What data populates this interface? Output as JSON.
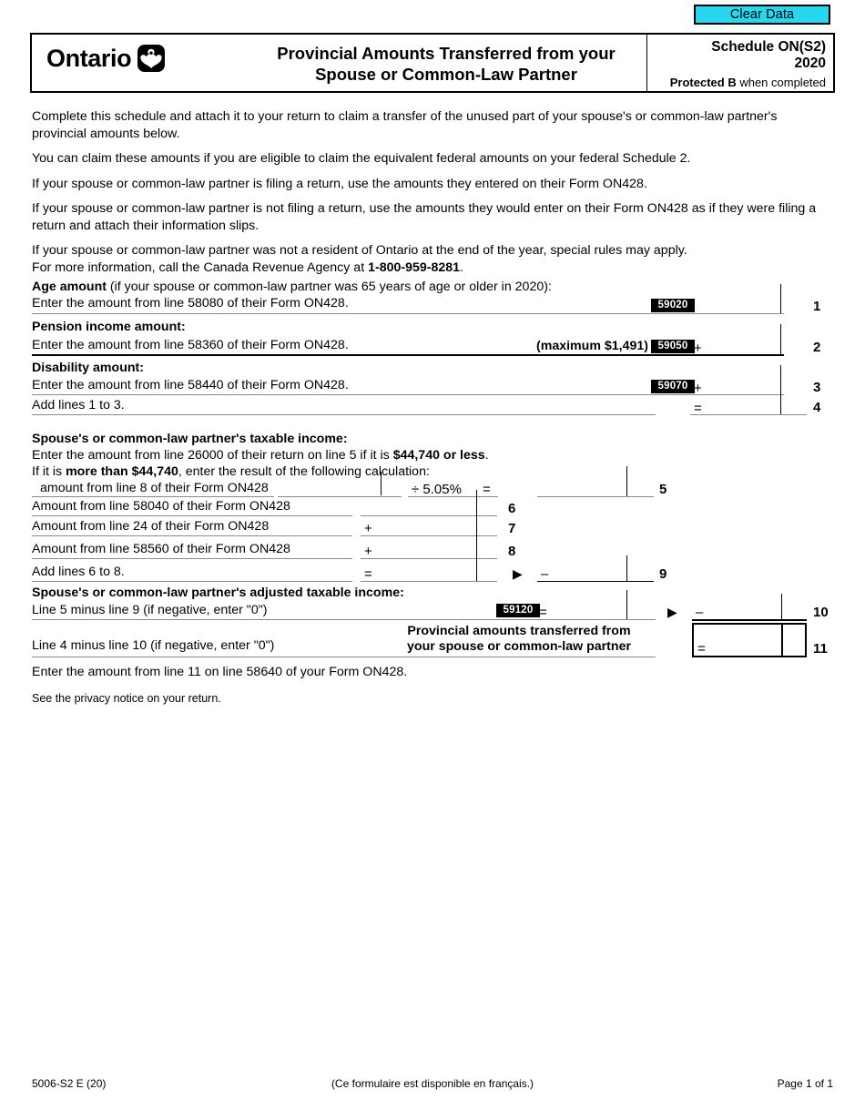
{
  "toolbar": {
    "clear_data_label": "Clear Data",
    "clear_data_color": "#27d7ee"
  },
  "header": {
    "province": "Ontario",
    "logo_icon": "ontario-trillium-icon",
    "title_line1": "Provincial Amounts Transferred from your",
    "title_line2": "Spouse or Common-Law Partner",
    "schedule": "Schedule ON(S2)",
    "year": "2020",
    "protected_bold": "Protected B",
    "protected_rest": " when completed"
  },
  "intro": {
    "p1_a": "Complete this schedule and attach it to your return to claim a transfer of the unused part of your spouse's or common-law partner's provincial amounts below.",
    "p2": "You can claim these amounts if you are eligible to claim the equivalent federal amounts on your federal Schedule 2.",
    "p3": "If your spouse or common-law partner is filing a return, use the amounts they entered on their Form ON428.",
    "p4": "If your spouse or common-law partner is not filing a return, use the amounts they would enter on their Form ON428 as if they were filing a return and attach their information slips.",
    "p5_a": "If your spouse or common-law partner was not a resident of Ontario at the end of the year, special rules may apply.",
    "p5_b": "For more information, call the Canada Revenue Agency at ",
    "p5_phone": "1-800-959-8281",
    "p5_c": "."
  },
  "lines": {
    "l1": {
      "heading_bold": "Age amount",
      "heading_rest": " (if your spouse or common-law partner was 65 years of age or older in 2020):",
      "sub": "Enter the amount from line 58080 of their Form ON428.",
      "code": "59020",
      "number": "1",
      "value": ""
    },
    "l2": {
      "heading": "Pension income amount:",
      "sub": "Enter the amount from line 58360 of their Form ON428.",
      "maximum": "(maximum $1,491)",
      "code": "59050",
      "op": "+",
      "number": "2",
      "value": ""
    },
    "l3": {
      "heading": "Disability amount:",
      "sub": "Enter the amount from line 58440 of their Form ON428.",
      "code": "59070",
      "op": "+",
      "number": "3",
      "value": ""
    },
    "l4": {
      "label": "Add lines 1 to 3.",
      "op": "=",
      "number": "4",
      "value": ""
    },
    "l5": {
      "heading": "Spouse's or common-law partner's taxable income:",
      "sub1_a": "Enter the amount from line 26000 of their return on line 5 if it is ",
      "sub1_bold": "$44,740 or less",
      "sub1_b": ".",
      "sub2_a": "If it is ",
      "sub2_bold": "more than $44,740",
      "sub2_b": ", enter the result of the following calculation:",
      "calc_label": "amount from line 8 of their Form ON428",
      "divider_op": "÷  5.05%",
      "equals_op": "=",
      "number": "5",
      "value_a": "",
      "value_b": ""
    },
    "l6": {
      "label": "Amount from line 58040 of their Form ON428",
      "number": "6",
      "value": ""
    },
    "l7": {
      "label": "Amount from line 24 of their Form ON428",
      "op": "+",
      "number": "7",
      "value": ""
    },
    "l8": {
      "label": "Amount from line 58560 of their Form ON428",
      "op": "+",
      "number": "8",
      "value": ""
    },
    "l9": {
      "label": "Add lines 6 to 8.",
      "op": "=",
      "arrow": "▶",
      "minus": "–",
      "number": "9",
      "value_a": "",
      "value_b": ""
    },
    "l10": {
      "heading": "Spouse's or common-law partner's adjusted taxable income:",
      "sub": "Line 5 minus line 9 (if negative, enter \"0\")",
      "code": "59120",
      "op": "=",
      "arrow": "▶",
      "minus": "–",
      "number": "10",
      "value_a": "",
      "value_b": ""
    },
    "l11": {
      "label": "Line 4 minus line 10 (if negative, enter \"0\")",
      "title_line1": "Provincial amounts transferred from",
      "title_line2": "your spouse or common-law partner",
      "op": "=",
      "number": "11",
      "value": ""
    },
    "closing": "Enter the amount from line 11 on line 58640 of your Form ON428."
  },
  "footer": {
    "privacy": "See the privacy notice on your return.",
    "form_id": "5006-S2 E (20)",
    "french_note": "(Ce formulaire est disponible en français.)",
    "page": "Page 1 of 1"
  }
}
